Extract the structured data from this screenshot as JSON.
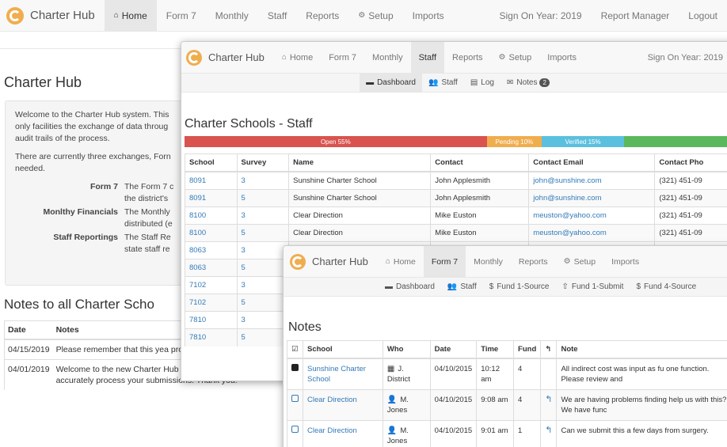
{
  "base": {
    "brand": "Charter Hub",
    "nav": [
      "Home",
      "Form 7",
      "Monthly",
      "Staff",
      "Reports",
      "Setup",
      "Imports"
    ],
    "nav_right": [
      "Sign On Year: 2019",
      "Report Manager",
      "Logout"
    ],
    "page_title": "Charter Hub",
    "intro_1": "Welcome to the Charter Hub system. This only facilities the exchange of data throug audit trails of the process.",
    "intro_2": "There are currently three exchanges, Forn needed.",
    "defs": [
      {
        "term": "Form 7",
        "desc": "The Form 7 c the district's"
      },
      {
        "term": "Monlthy Financials",
        "desc": "The Monthly distributed (e"
      },
      {
        "term": "Staff Reportings",
        "desc": "The Staff Re state staff re"
      }
    ],
    "notes_title": "Notes to all Charter Scho",
    "notes_headers": [
      "Date",
      "Notes"
    ],
    "notes_rows": [
      {
        "date": "04/15/2019",
        "note": "Please remember that this yea process all charter schools dat"
      },
      {
        "date": "04/01/2019",
        "note": "Welcome to the new Charter Hub system. All data subm and accurately process your submissions. Thank you!"
      }
    ]
  },
  "staff_window": {
    "brand": "Charter Hub",
    "nav": [
      "Home",
      "Form 7",
      "Monthly",
      "Staff",
      "Reports",
      "Setup",
      "Imports"
    ],
    "nav_right": "Sign On Year: 2019",
    "sub": [
      "Dashboard",
      "Staff",
      "Log",
      "Notes"
    ],
    "notes_badge": "2",
    "title": "Charter Schools - Staff",
    "progress": [
      {
        "label": "Open 55%",
        "value": 55,
        "color": "#d9534f"
      },
      {
        "label": "Pending 10%",
        "value": 10,
        "color": "#f0ad4e"
      },
      {
        "label": "Verified 15%",
        "value": 15,
        "color": "#5bc0de"
      },
      {
        "label": "",
        "value": 20,
        "color": "#5cb85c"
      }
    ],
    "headers": [
      "School",
      "Survey",
      "Name",
      "Contact",
      "Contact Email",
      "Contact Pho"
    ],
    "rows": [
      [
        "8091",
        "3",
        "Sunshine Charter School",
        "John Applesmith",
        "john@sunshine.com",
        "(321) 451-09"
      ],
      [
        "8091",
        "5",
        "Sunshine Charter School",
        "John Applesmith",
        "john@sunshine.com",
        "(321) 451-09"
      ],
      [
        "8100",
        "3",
        "Clear Direction",
        "Mike Euston",
        "meuston@yahoo.com",
        "(321) 451-09"
      ],
      [
        "8100",
        "5",
        "Clear Direction",
        "Mike Euston",
        "meuston@yahoo.com",
        "(321) 451-09"
      ],
      [
        "8063",
        "3",
        "",
        "",
        "",
        ""
      ],
      [
        "8063",
        "5",
        "",
        "",
        "",
        ""
      ],
      [
        "7102",
        "3",
        "",
        "",
        "",
        ""
      ],
      [
        "7102",
        "5",
        "",
        "",
        "",
        ""
      ],
      [
        "7810",
        "3",
        "",
        "",
        "",
        ""
      ],
      [
        "7810",
        "5",
        "",
        "",
        "",
        ""
      ]
    ]
  },
  "notes_window": {
    "brand": "Charter Hub",
    "nav": [
      "Home",
      "Form 7",
      "Monthly",
      "Reports",
      "Setup",
      "Imports"
    ],
    "sub": [
      "Dashboard",
      "Staff",
      "Fund 1-Source",
      "Fund 1-Submit",
      "Fund 4-Source"
    ],
    "title": "Notes",
    "headers": [
      "School",
      "Who",
      "Date",
      "Time",
      "Fund",
      "Note"
    ],
    "rows": [
      {
        "school": "Sunshine Charter School",
        "who": "J. District",
        "date": "04/10/2015",
        "time": "10:12 am",
        "fund": "4",
        "reply": false,
        "checked": true,
        "note": "All indirect cost was input as fu one function. Please review and"
      },
      {
        "school": "Clear Direction",
        "who": "M. Jones",
        "date": "04/10/2015",
        "time": "9:08 am",
        "fund": "4",
        "reply": true,
        "checked": false,
        "note": "We are having problems finding help us with this? We have func"
      },
      {
        "school": "Clear Direction",
        "who": "M. Jones",
        "date": "04/10/2015",
        "time": "9:01 am",
        "fund": "1",
        "reply": true,
        "checked": false,
        "note": "Can we submit this a few days from surgery."
      }
    ]
  }
}
